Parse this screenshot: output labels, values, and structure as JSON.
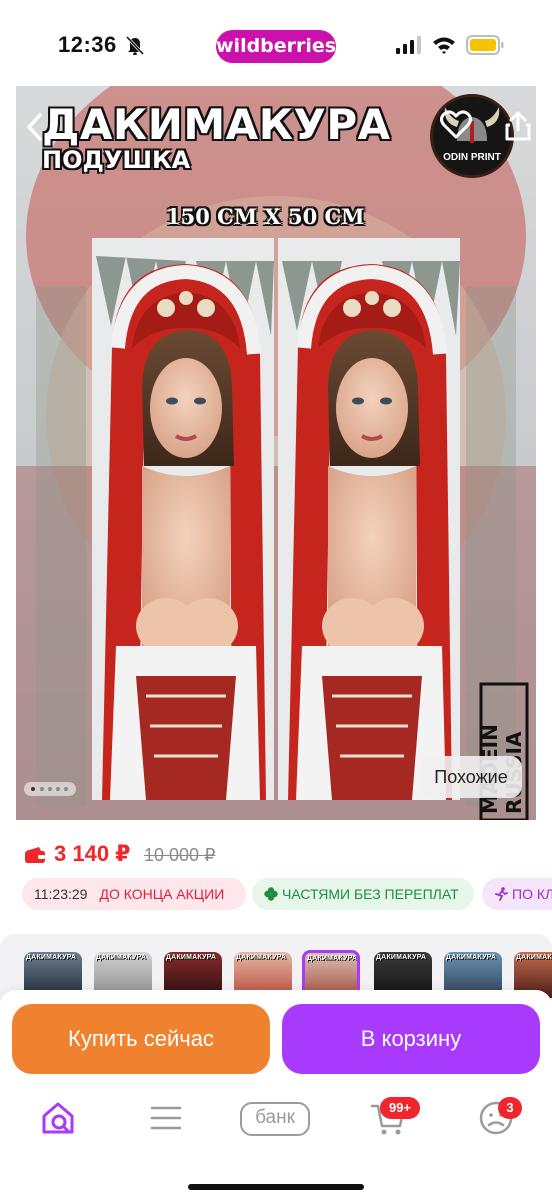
{
  "status_bar": {
    "time": "12:36",
    "brand": "wildberries",
    "icons": [
      "bell-slash-icon",
      "cellular-signal-icon",
      "wifi-icon",
      "battery-icon"
    ]
  },
  "gallery": {
    "title": "ДАКИМАКУРА",
    "subtitle": "ПОДУШКА",
    "size_label": "150 CM X 50 CM",
    "logo_text": "ODIN PRINT",
    "similar_button": "Похожие",
    "image_count": 5,
    "active_index": 0
  },
  "price": {
    "current": "3 140 ₽",
    "old": "10 000 ₽",
    "current_color": "#f0262c"
  },
  "promos": [
    {
      "time": "11:23:29",
      "label": "ДО КОНЦА АКЦИИ"
    },
    {
      "label": "ЧАСТЯМИ БЕЗ ПЕРЕПЛАТ"
    },
    {
      "label": "ПО КЛ"
    }
  ],
  "variants": {
    "thumb_label": "ДАКИМАКУРА",
    "selected_index": 4
  },
  "actions": {
    "buy_now": "Купить сейчас",
    "add_to_cart": "В корзину",
    "buy_color": "#f0812f",
    "cart_color": "#a73afd"
  },
  "bottom_nav": {
    "items": [
      "home-search-icon",
      "catalog-menu-icon",
      "bank",
      "cart-icon",
      "profile-icon"
    ],
    "bank_label": "банк",
    "cart_badge": "99+",
    "profile_badge": "3"
  }
}
